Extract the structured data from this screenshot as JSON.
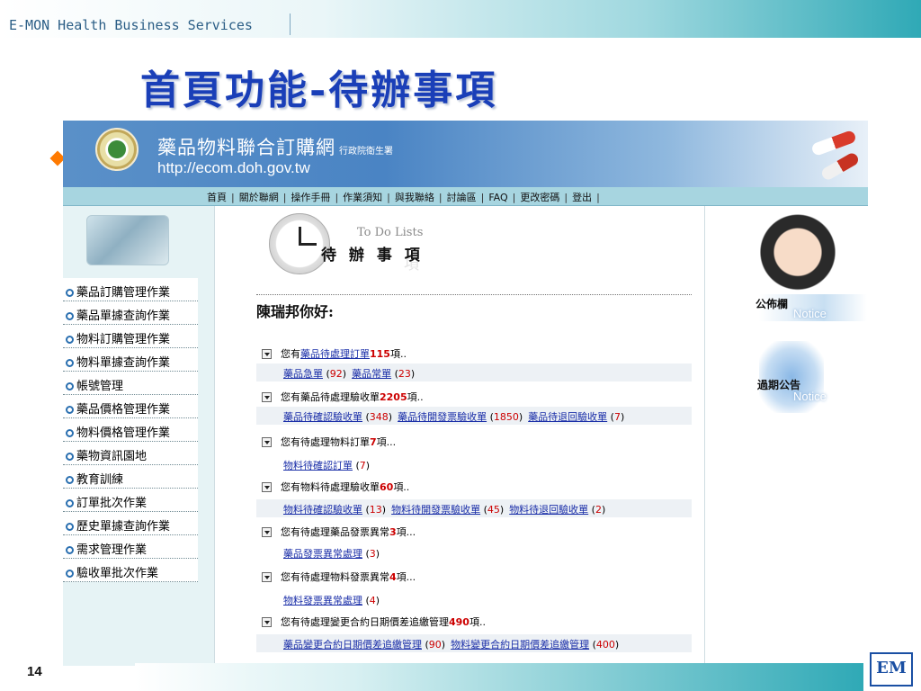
{
  "slide": {
    "company": "E-MON Health Business Services",
    "title": "首頁功能-待辦事項",
    "page_number": "14",
    "logo_text": "EM"
  },
  "site": {
    "name": "藥品物料聯合訂購網",
    "org": "行政院衛生署",
    "url": "http://ecom.doh.gov.tw"
  },
  "nav": [
    "首頁",
    "關於聯網",
    "操作手冊",
    "作業須知",
    "與我聯絡",
    "討論區",
    "FAQ",
    "更改密碼",
    "登出"
  ],
  "nav_separator": "|",
  "menu": [
    "藥品訂購管理作業",
    "藥品單據查詢作業",
    "物料訂購管理作業",
    "物料單據查詢作業",
    "帳號管理",
    "藥品價格管理作業",
    "物料價格管理作業",
    "藥物資訊園地",
    "教育訓練",
    "訂單批次作業",
    "歷史單據查詢作業",
    "需求管理作業",
    "驗收單批次作業"
  ],
  "todo": {
    "title_en": "To Do Lists",
    "title_zh": "待 辦 事 項",
    "title_zh_shadow": "項",
    "greeting": "陳瑞邦你好:"
  },
  "tasks": [
    {
      "prefix": "您有",
      "link_prefix": "藥品待處理訂單",
      "count": "115",
      "suffix": "項..",
      "links": [
        {
          "text": "藥品急單",
          "num": "92"
        },
        {
          "text": "藥品常單",
          "num": "23"
        }
      ]
    },
    {
      "prefix": "您有藥品待處理驗收單",
      "count": "2205",
      "suffix": "項..",
      "links": [
        {
          "text": "藥品待確認驗收單",
          "num": "348"
        },
        {
          "text": "藥品待開發票驗收單",
          "num": "1850"
        },
        {
          "text": "藥品待退回驗收單",
          "num": "7"
        }
      ]
    },
    {
      "prefix": "您有待處理物料訂單",
      "count": "7",
      "suffix": "項...",
      "links": [
        {
          "text": "物料待確認訂單",
          "num": "7"
        }
      ]
    },
    {
      "prefix": "您有物料待處理驗收單",
      "count": "60",
      "suffix": "項..",
      "links": [
        {
          "text": "物料待確認驗收單",
          "num": "13"
        },
        {
          "text": "物料待開發票驗收單",
          "num": "45"
        },
        {
          "text": "物料待退回驗收單",
          "num": "2"
        }
      ]
    },
    {
      "prefix": "您有待處理藥品發票異常",
      "count": "3",
      "suffix": "項...",
      "links": [
        {
          "text": "藥品發票異常處理",
          "num": "3"
        }
      ]
    },
    {
      "prefix": "您有待處理物料發票異常",
      "count": "4",
      "suffix": "項...",
      "links": [
        {
          "text": "物料發票異常處理",
          "num": "4"
        }
      ]
    },
    {
      "prefix": "您有待處理變更合約日期價差追繳管理",
      "count": "490",
      "suffix": "項..",
      "links": [
        {
          "text": "藥品變更合約日期價差追繳管理",
          "num": "90"
        },
        {
          "text": "物料變更合約日期價差追繳管理",
          "num": "400"
        }
      ]
    }
  ],
  "notices": {
    "bulletin_zh": "公佈欄",
    "bulletin_en": "Notice",
    "expired_zh": "過期公告",
    "expired_en": "Notice"
  },
  "colors": {
    "title": "#1a3fb8",
    "link": "#1a2ea8",
    "count": "#cc0000",
    "navbar": "#a7d5e0"
  }
}
